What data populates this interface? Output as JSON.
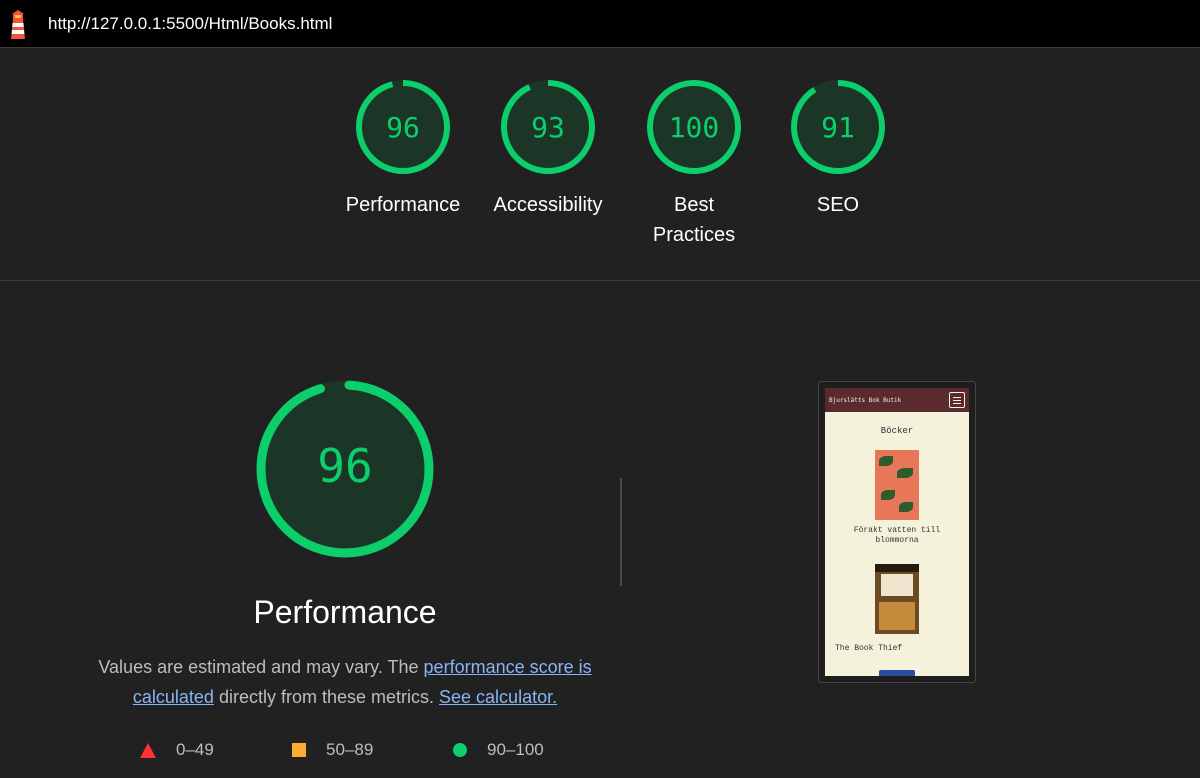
{
  "header": {
    "url": "http://127.0.0.1:5500/Html/Books.html",
    "logo_icon": "lighthouse-icon"
  },
  "gauges": [
    {
      "score": "96",
      "label": "Performance",
      "fraction": 0.96
    },
    {
      "score": "93",
      "label": "Accessibility",
      "fraction": 0.93
    },
    {
      "score": "100",
      "label": "Best Practices",
      "fraction": 1.0
    },
    {
      "score": "91",
      "label": "SEO",
      "fraction": 0.91
    }
  ],
  "performance": {
    "score": "96",
    "fraction": 0.96,
    "title": "Performance",
    "desc_prefix": "Values are estimated and may vary. The ",
    "link_score": "performance score is calculated",
    "desc_middle": " directly from these metrics. ",
    "link_calc": "See calculator."
  },
  "legend": {
    "fail": "0–49",
    "average": "50–89",
    "pass": "90–100"
  },
  "screenshot": {
    "brand": "Bjurslätts Bok Butik",
    "heading": "Böcker",
    "book1_title": "Förakt vatten till blommorna",
    "book2_title": "The Book Thief"
  },
  "colors": {
    "pass": "#0cce6b",
    "pass_bg": "#1b3527",
    "average": "#ffaa33",
    "fail": "#ff3333",
    "link": "#8ab4f8"
  }
}
